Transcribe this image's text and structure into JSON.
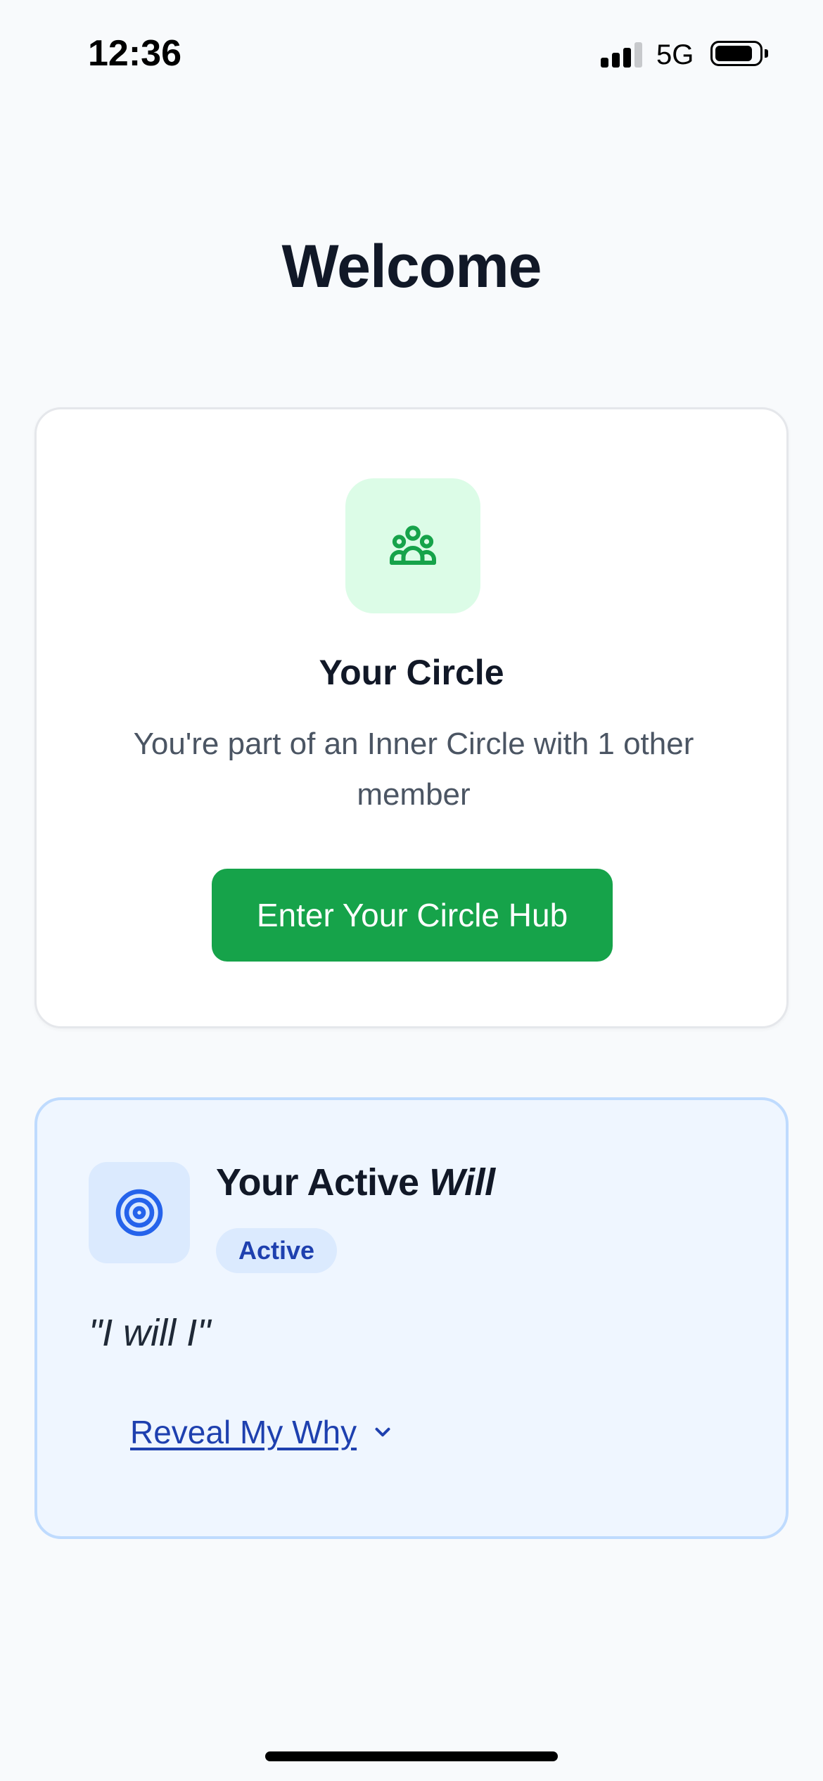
{
  "status_bar": {
    "time": "12:36",
    "network": "5G",
    "signal_bars_active": 3,
    "signal_bars_total": 4,
    "battery_icon": "battery-icon"
  },
  "page": {
    "title": "Welcome"
  },
  "circle_card": {
    "icon": "group-people-icon",
    "icon_color": "#16a34a",
    "icon_bg": "#dcfce7",
    "title": "Your Circle",
    "description": "You're part of an Inner Circle with 1 other member",
    "button_label": "Enter Your Circle Hub",
    "button_color": "#16a34a"
  },
  "will_card": {
    "icon": "target-icon",
    "icon_color": "#2563eb",
    "title_prefix": "Your Active ",
    "title_emphasis": "Will",
    "badge": "Active",
    "quote": "\"I will I\"",
    "reveal_label": "Reveal My Why",
    "reveal_icon": "chevron-down-icon",
    "accent": "#1e40af",
    "background": "#eff6ff",
    "border": "#bfdbfe"
  }
}
